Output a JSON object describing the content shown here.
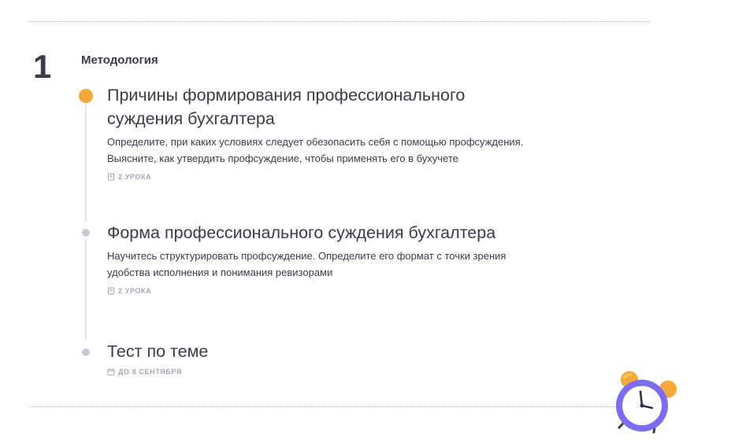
{
  "module": {
    "number": "1",
    "title": "Методология"
  },
  "lessons": [
    {
      "title": "Причины формирования профессионального суждения бухгалтера",
      "description": "Определите, при каких условиях следует обезопасить себя с помощью профсуждения. Выясните, как утвердить профсуждение, чтобы применять его в бухучете",
      "meta": "2 урока",
      "meta_icon": "book-icon",
      "status": "active"
    },
    {
      "title": "Форма профессионального суждения бухгалтера",
      "description": "Научитесь структурировать профсуждение. Определите его формат с точки зрения удобства исполнения и понимания ревизорами",
      "meta": "2 урока",
      "meta_icon": "book-icon",
      "status": "idle"
    },
    {
      "title": "Тест по теме",
      "meta": "до 8 сентября",
      "meta_icon": "calendar-icon",
      "status": "idle"
    }
  ],
  "colors": {
    "active_dot": "#f5a93b",
    "idle_dot": "#c7cad9",
    "clock_ring": "#7b6cf0",
    "clock_bells": "#f5a93b",
    "text": "#3b3c4a",
    "meta_text": "#a3a6b4"
  },
  "decorations": {
    "clock_icon": "alarm-clock-icon"
  }
}
